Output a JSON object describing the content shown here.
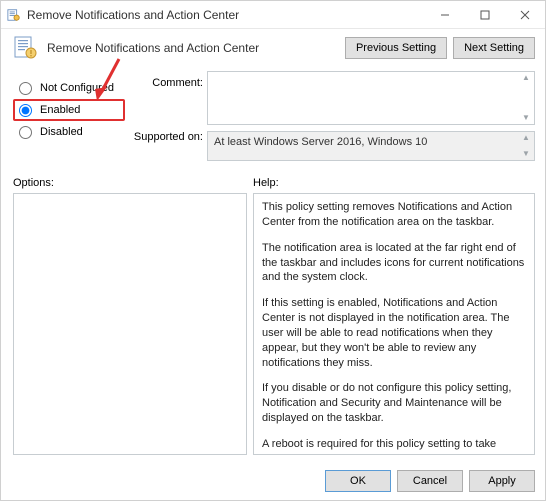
{
  "window": {
    "title": "Remove Notifications and Action Center"
  },
  "header": {
    "title": "Remove Notifications and Action Center",
    "prev": "Previous Setting",
    "next": "Next Setting"
  },
  "radios": {
    "not_configured": "Not Configured",
    "enabled": "Enabled",
    "disabled": "Disabled",
    "selected": "enabled"
  },
  "labels": {
    "comment": "Comment:",
    "supported": "Supported on:",
    "options": "Options:",
    "help": "Help:"
  },
  "supported_text": "At least Windows Server 2016, Windows 10",
  "comment_text": "",
  "help": {
    "p1": "This policy setting removes Notifications and Action Center from the notification area on the taskbar.",
    "p2": "The notification area is located at the far right end of the taskbar and includes icons for current notifications and the system clock.",
    "p3": "If this setting is enabled, Notifications and Action Center is not displayed in the notification area. The user will be able to read notifications when they appear, but they won't be able to review any notifications they miss.",
    "p4": "If you disable or do not configure this policy setting, Notification and Security and Maintenance will be displayed on the taskbar.",
    "p5": "A reboot is required for this policy setting to take effect."
  },
  "buttons": {
    "ok": "OK",
    "cancel": "Cancel",
    "apply": "Apply"
  }
}
